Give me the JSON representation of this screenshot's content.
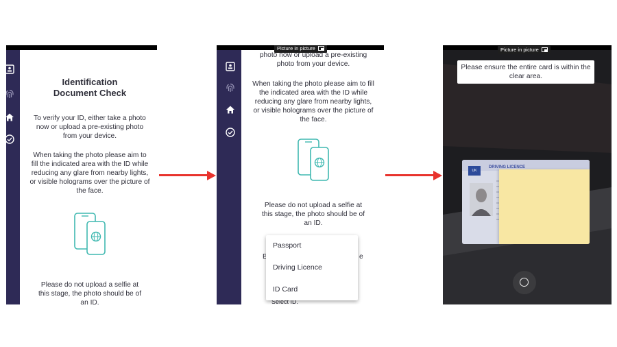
{
  "screen1": {
    "title": "Identification Document Check",
    "intro": "To verify your ID, either take a photo now or upload a pre-existing photo from your device.",
    "guidance": "When taking the photo please aim to fill the indicated area with the ID while reducing any glare from nearby lights, or visible holograms over the picture of the face.",
    "warning": "Please do not upload a selfie at this stage, the photo should be of an ID."
  },
  "screen2": {
    "pip_label": "Picture in picture",
    "intro_tail": "photo now or upload a pre-existing photo from your device.",
    "guidance": "When taking the photo please aim to fill the indicated area with the ID while reducing any glare from nearby lights, or visible holograms over the picture of the face.",
    "warning": "Please do not upload a selfie at this stage, the photo should be of an ID.",
    "peek_left": "B",
    "peek_right": "e",
    "peek_bottom": "Select ID.",
    "dropdown_options": [
      "Passport",
      "Driving Licence",
      "ID Card"
    ]
  },
  "screen3": {
    "pip_label": "Picture in picture",
    "camera_message": "Please ensure the entire card is within the clear area.",
    "licence_header": "DRIVING LICENCE",
    "licence_country": "UK"
  },
  "colors": {
    "sidebar": "#2e2a56",
    "arrow": "#e8332d",
    "icon_teal": "#3fb8b0"
  }
}
